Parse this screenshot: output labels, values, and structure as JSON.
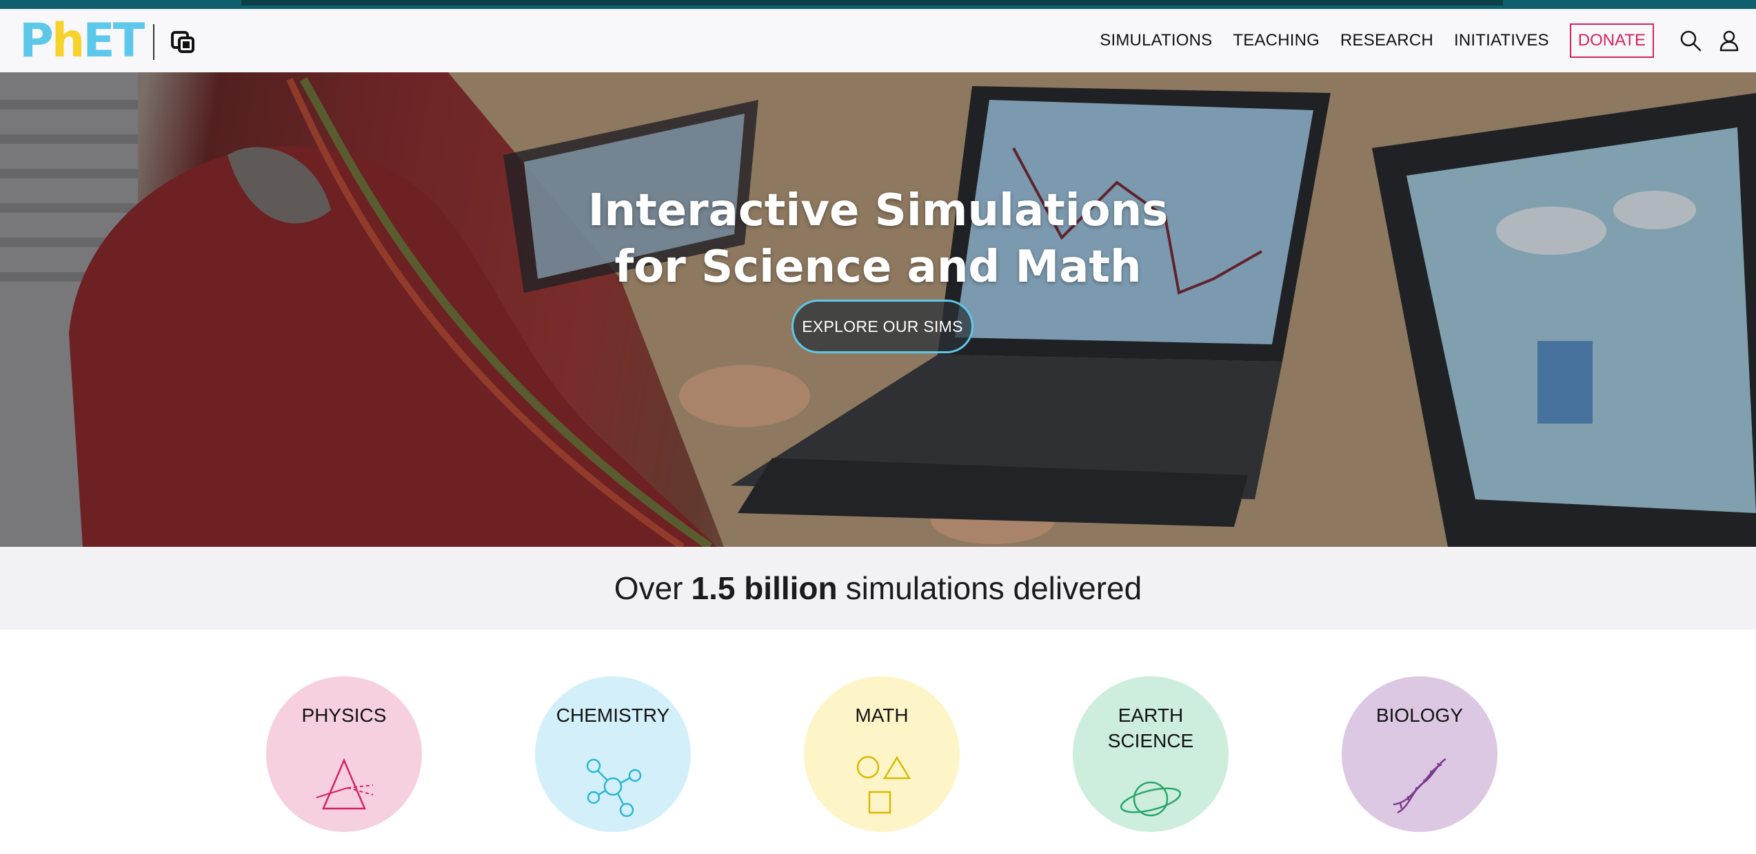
{
  "header": {
    "logo_text_a": "P",
    "logo_text_b": "h",
    "logo_text_c": "ET",
    "nav": [
      "SIMULATIONS",
      "TEACHING",
      "RESEARCH",
      "INITIATIVES"
    ],
    "donate_label": "DONATE",
    "icons": [
      "search-icon",
      "user-icon"
    ]
  },
  "hero": {
    "title_line1": "Interactive Simulations",
    "title_line2": "for Science and Math",
    "button_label": "EXPLORE OUR SIMS"
  },
  "stats": {
    "prefix": "Over",
    "highlight": "1.5 billion",
    "suffix": "simulations delivered"
  },
  "categories": [
    {
      "label": "PHYSICS",
      "color": "#f6cfe0",
      "icon": "prism-icon",
      "icon_color": "#d6225f"
    },
    {
      "label": "CHEMISTRY",
      "color": "#d3f0fa",
      "icon": "molecule-icon",
      "icon_color": "#2bb6d0"
    },
    {
      "label": "MATH",
      "color": "#fdf5c7",
      "icon": "shapes-icon",
      "icon_color": "#d9b800"
    },
    {
      "label_line1": "EARTH",
      "label_line2": "SCIENCE",
      "color": "#cdeedc",
      "icon": "planet-icon",
      "icon_color": "#2aa56d"
    },
    {
      "label": "BIOLOGY",
      "color": "#dcc8e2",
      "icon": "dna-icon",
      "icon_color": "#7a3b8c"
    }
  ]
}
